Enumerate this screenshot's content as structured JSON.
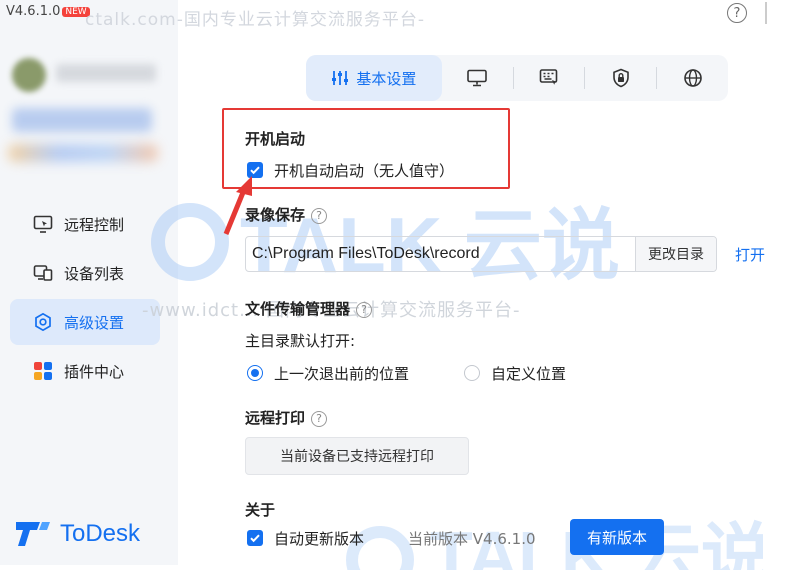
{
  "app": {
    "version": "V4.6.1.0",
    "new_badge": "NEW",
    "watermark_top": "ctalk.com-国内专业云计算交流服务平台-",
    "watermark_mid": "-www.idct... 国内专业云计算交流服务平台-",
    "watermark_logo_text": "TALK 云说",
    "logo_text": "ToDesk",
    "help_icon": "question-circle-icon"
  },
  "sidebar": {
    "items": [
      {
        "label": "远程控制",
        "icon": "remote-control-icon",
        "active": false
      },
      {
        "label": "设备列表",
        "icon": "device-list-icon",
        "active": false
      },
      {
        "label": "高级设置",
        "icon": "advanced-settings-icon",
        "active": true
      },
      {
        "label": "插件中心",
        "icon": "plugin-center-icon",
        "active": false
      }
    ]
  },
  "tabs": [
    {
      "label": "基本设置",
      "icon": "sliders-icon",
      "active": true
    },
    {
      "label": "",
      "icon": "monitor-icon",
      "active": false
    },
    {
      "label": "",
      "icon": "keyboard-icon",
      "active": false
    },
    {
      "label": "",
      "icon": "shield-lock-icon",
      "active": false
    },
    {
      "label": "",
      "icon": "globe-icon",
      "active": false
    }
  ],
  "startup": {
    "title": "开机启动",
    "checkbox_label": "开机自动启动（无人值守）",
    "checked": true
  },
  "recording": {
    "title": "录像保存",
    "path": "C:\\Program Files\\ToDesk\\record",
    "change_button": "更改目录",
    "open_link": "打开"
  },
  "file_transfer": {
    "title": "文件传输管理器",
    "subtitle": "主目录默认打开:",
    "options": [
      {
        "label": "上一次退出前的位置",
        "selected": true
      },
      {
        "label": "自定义位置",
        "selected": false
      }
    ]
  },
  "remote_print": {
    "title": "远程打印",
    "button": "当前设备已支持远程打印"
  },
  "about": {
    "title": "关于",
    "auto_update_label": "自动更新版本",
    "auto_update_checked": true,
    "current_version": "当前版本 V4.6.1.0",
    "new_version_button": "有新版本"
  },
  "colors": {
    "accent": "#1470f0",
    "highlight_box": "#e53935",
    "new_badge": "#f4423b"
  }
}
